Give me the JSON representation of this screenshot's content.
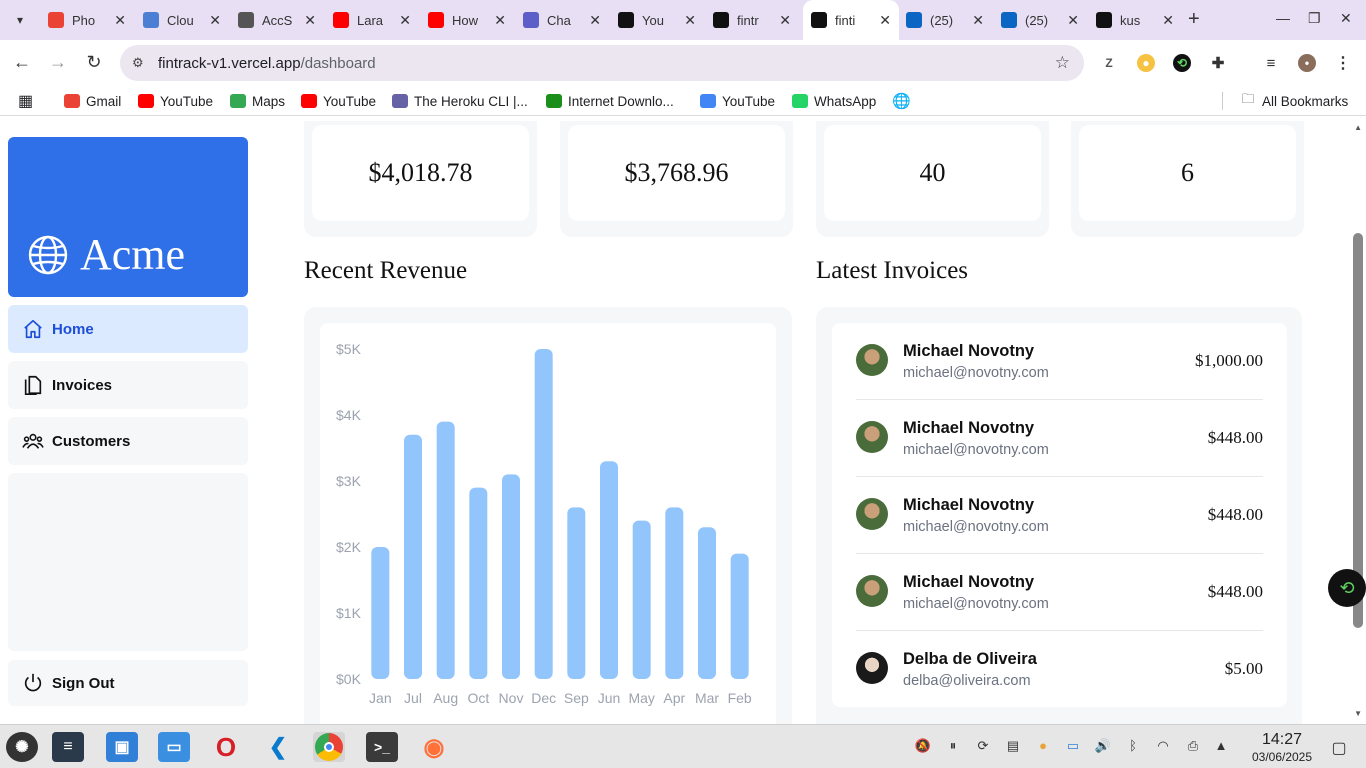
{
  "browser": {
    "tabs": [
      {
        "label": "Pho",
        "icon": "gmail-icon",
        "color": "#ea4335"
      },
      {
        "label": "Clou",
        "icon": "cloud-icon",
        "color": "#4a7fd4"
      },
      {
        "label": "AccS",
        "icon": "globe-icon",
        "color": "#555555"
      },
      {
        "label": "Lara",
        "icon": "youtube-icon",
        "color": "#ff0000"
      },
      {
        "label": "How",
        "icon": "youtube-icon",
        "color": "#ff0000"
      },
      {
        "label": "Cha",
        "icon": "teams-icon",
        "color": "#5b5fc7"
      },
      {
        "label": "You",
        "icon": "github-icon",
        "color": "#111111"
      },
      {
        "label": "fintr",
        "icon": "vercel-icon",
        "color": "#111111"
      },
      {
        "label": "finti",
        "icon": "nextjs-icon",
        "color": "#111111"
      },
      {
        "label": "(25)",
        "icon": "linkedin-icon",
        "color": "#0a66c2"
      },
      {
        "label": "(25)",
        "icon": "linkedin-icon",
        "color": "#0a66c2"
      },
      {
        "label": "kus",
        "icon": "github-icon",
        "color": "#111111"
      }
    ],
    "active_tab_index": 8,
    "url_host": "fintrack-v1.vercel.app",
    "url_path": "/dashboard",
    "bookmarks": [
      {
        "label": "Gmail",
        "icon": "gmail-icon",
        "color": "#ea4335"
      },
      {
        "label": "YouTube",
        "icon": "youtube-icon",
        "color": "#ff0000"
      },
      {
        "label": "Maps",
        "icon": "maps-icon",
        "color": "#34a853"
      },
      {
        "label": "YouTube",
        "icon": "youtube-icon",
        "color": "#ff0000"
      },
      {
        "label": "The Heroku CLI |...",
        "icon": "heroku-icon",
        "color": "#6762a6"
      },
      {
        "label": "Internet Downlo...",
        "icon": "idm-icon",
        "color": "#1a8f1a"
      },
      {
        "label": "YouTube",
        "icon": "google-icon",
        "color": "#4285f4"
      },
      {
        "label": "WhatsApp",
        "icon": "whatsapp-icon",
        "color": "#25d366"
      }
    ],
    "all_bookmarks_label": "All Bookmarks"
  },
  "sidebar": {
    "brand": "Acme",
    "brand_color": "#2f6fe8",
    "links": [
      {
        "label": "Home",
        "icon": "home-icon",
        "active": true
      },
      {
        "label": "Invoices",
        "icon": "document-icon",
        "active": false
      },
      {
        "label": "Customers",
        "icon": "users-icon",
        "active": false
      }
    ],
    "sign_out": "Sign Out"
  },
  "cards": [
    "$4,018.78",
    "$3,768.96",
    "40",
    "6"
  ],
  "revenue": {
    "title": "Recent Revenue",
    "bar_color": "#93c5fd"
  },
  "chart_data": {
    "type": "bar",
    "categories": [
      "Jan",
      "Jul",
      "Aug",
      "Oct",
      "Nov",
      "Dec",
      "Sep",
      "Jun",
      "May",
      "Apr",
      "Mar",
      "Feb"
    ],
    "values": [
      2000,
      3700,
      3900,
      2900,
      3100,
      5000,
      2600,
      3300,
      2400,
      2600,
      2300,
      1900
    ],
    "ytick_labels": [
      "$5K",
      "$4K",
      "$3K",
      "$2K",
      "$1K",
      "$0K"
    ],
    "ylim": [
      0,
      5000
    ],
    "grid": false
  },
  "invoices": {
    "title": "Latest Invoices",
    "rows": [
      {
        "name": "Michael Novotny",
        "email": "michael@novotny.com",
        "amount": "$1,000.00"
      },
      {
        "name": "Michael Novotny",
        "email": "michael@novotny.com",
        "amount": "$448.00"
      },
      {
        "name": "Michael Novotny",
        "email": "michael@novotny.com",
        "amount": "$448.00"
      },
      {
        "name": "Michael Novotny",
        "email": "michael@novotny.com",
        "amount": "$448.00"
      },
      {
        "name": "Delba de Oliveira",
        "email": "delba@oliveira.com",
        "amount": "$5.00"
      }
    ]
  },
  "taskbar": {
    "time": "14:27",
    "date": "03/06/2025"
  }
}
